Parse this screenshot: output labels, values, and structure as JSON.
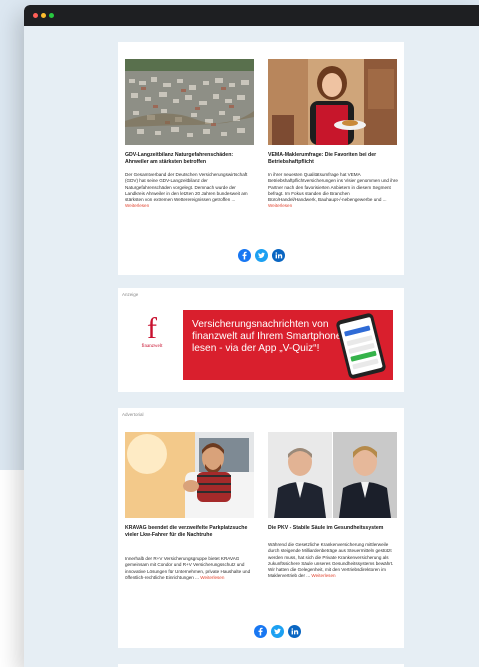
{
  "articles_top": [
    {
      "title": "GDV-Langzeitbilanz Naturgefahrenschäden: Ahrweiler am stärksten betroffen",
      "text": "Der Gesamtverband der Deutschen Versicherungswirtschaft (GDV) hat seine GDV-Langzeitbilanz der Naturgefahrenschäden vorgelegt. Demnach wurde der Landkreis Ahrweiler in den letzten 20 Jahren bundesweit am stärksten von extremen Wetterereignissen getroffen ...",
      "more": "Weiterlesen"
    },
    {
      "title": "VEMA-Maklerumfrage: Die Favoriten bei der Betriebshaftpflicht",
      "text": "In ihrer neuesten Qualitätsumfrage hat VEMA Betriebshaftpflichtversicherungen ins Visier genommen und ihre Partner nach den favorisierten Anbietern in diesem Segment befragt. Im Fokus standen die Branchen Büro/Handel/Handwerk, Bauhaupt-/-nebengewerbe und ...",
      "more": "Weiterlesen"
    }
  ],
  "ad": {
    "label": "Anzeige",
    "logo_letter": "f",
    "logo_name": "finanzwelt",
    "headline": "Versicherungsnachrichten von finanzwelt auf Ihrem Smartphone lesen - via der App „V-Quiz“!"
  },
  "advertorial": {
    "label": "Advertorial",
    "articles": [
      {
        "title": "KRAVAG beendet die verzweifelte Parkplatzsuche vieler Lkw-Fahrer für die Nachtruhe",
        "text": "Innerhalb der R+V Versicherungsgruppe bietet KRAVAG gemeinsam mit Condor und R+V Versicherungsschutz und innovative Lösungen für Unternehmen, private Haushalte und öffentlich-rechtliche Einrichtungen ...",
        "more": "Weiterlesen"
      },
      {
        "title": "Die PKV - Stabile Säule im Gesundheitssystem",
        "text": "Während die Gesetzliche Krankenversicherung mittlerweile durch steigende Milliardenbeträge aus Steuermitteln gestützt werden muss, hat sich die Private Krankenversicherung als zukunftssichere Säule unseres Gesundheitssystems bewährt. Wir hatten die Gelegenheit, mit den Vertriebsdirektoren im Maklervertrieb der ...",
        "more": "Weiterlesen"
      }
    ]
  },
  "social": {
    "icons": [
      "facebook-icon",
      "twitter-icon",
      "linkedin-icon"
    ],
    "colors": {
      "facebook": "#1877f2",
      "twitter": "#1da1f2",
      "linkedin": "#0a66c2"
    }
  },
  "colors": {
    "accent_link": "#e2442f",
    "ad_red": "#d91f2d"
  }
}
